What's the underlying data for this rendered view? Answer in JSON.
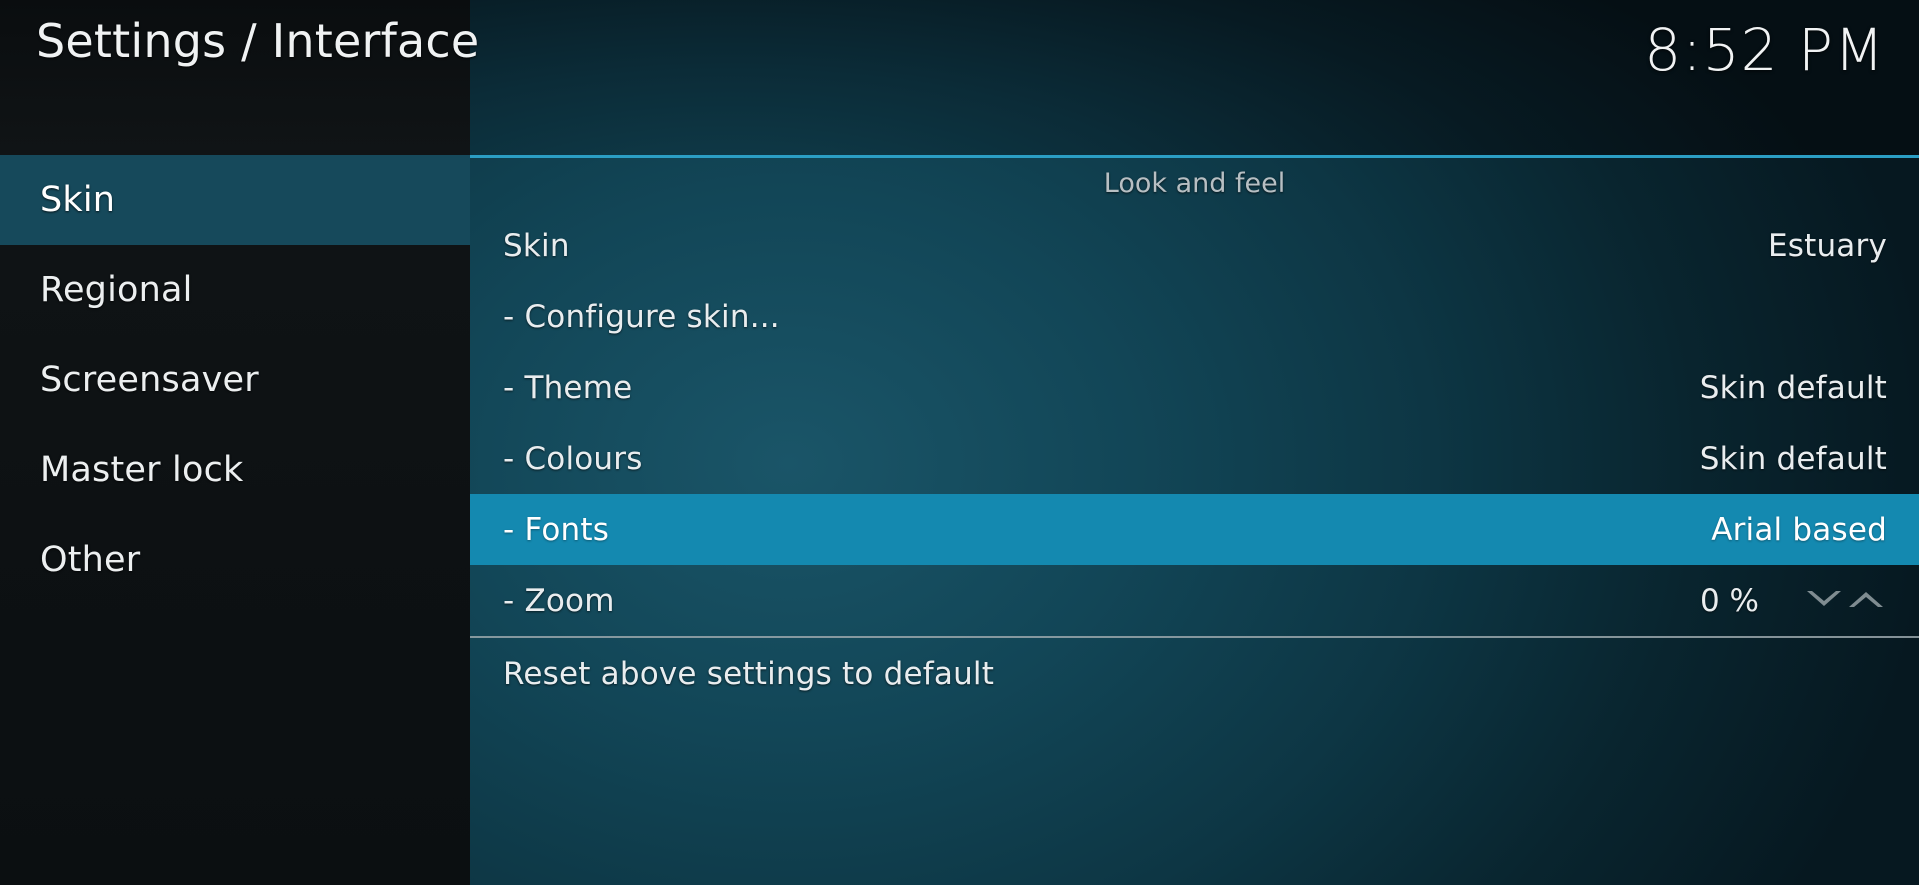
{
  "header": {
    "title": "Settings / Interface",
    "clock": "8:52 PM"
  },
  "sidebar": {
    "items": [
      {
        "label": "Skin",
        "selected": true
      },
      {
        "label": "Regional",
        "selected": false
      },
      {
        "label": "Screensaver",
        "selected": false
      },
      {
        "label": "Master lock",
        "selected": false
      },
      {
        "label": "Other",
        "selected": false
      }
    ]
  },
  "main": {
    "section_title": "Look and feel",
    "rows": [
      {
        "label": "Skin",
        "value": "Estuary",
        "highlight": false,
        "type": "select"
      },
      {
        "label": "- Configure skin...",
        "value": "",
        "highlight": false,
        "type": "action"
      },
      {
        "label": "- Theme",
        "value": "Skin default",
        "highlight": false,
        "type": "select"
      },
      {
        "label": "- Colours",
        "value": "Skin default",
        "highlight": false,
        "type": "select"
      },
      {
        "label": "- Fonts",
        "value": "Arial based",
        "highlight": true,
        "type": "select"
      },
      {
        "label": "- Zoom",
        "value": "0 %",
        "highlight": false,
        "type": "spinner"
      }
    ],
    "footer_row": {
      "label": "Reset above settings to default"
    },
    "spinner_icons": {
      "down": "chevron-down-icon",
      "up": "chevron-up-icon"
    }
  },
  "colors": {
    "accent_border": "#2b9ec4",
    "row_highlight": "#1489b0",
    "sidebar_selected": "#16495b",
    "separator": "#9aa7ac",
    "text": "#e9edef",
    "section_title": "#b7bfc3"
  }
}
